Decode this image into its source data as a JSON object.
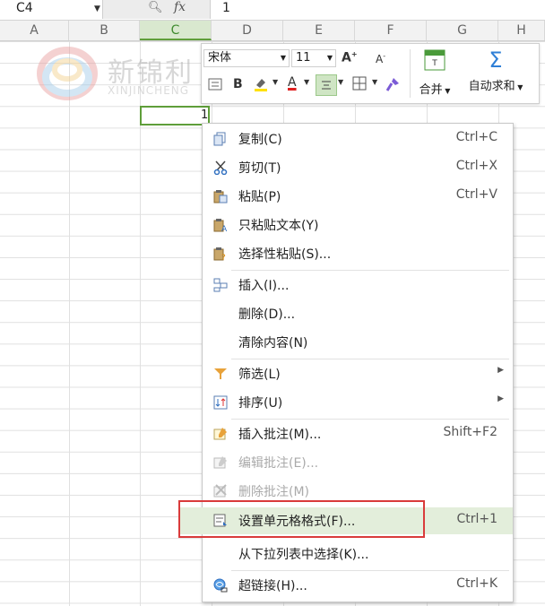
{
  "formula_bar": {
    "name_box": "C4",
    "zoom_icon": "magnifier-icon",
    "fx_label": "fx",
    "value": "1"
  },
  "columns": [
    "A",
    "B",
    "C",
    "D",
    "E",
    "F",
    "G",
    "H"
  ],
  "selected_column": "C",
  "cell_value": "1",
  "watermark": {
    "text1": "新锦利",
    "text2": "XINJINCHENG"
  },
  "mini_toolbar": {
    "font_name": "宋体",
    "font_size": "11",
    "increase_font": "A",
    "decrease_font": "A",
    "bold": "B",
    "font_color_letter": "A",
    "merge_label": "合并",
    "autosum_label": "自动求和",
    "autosum_icon": "Σ",
    "colors": {
      "highlight": "#ffe100",
      "font_color": "#e02020",
      "align_active": "#cfe5c4"
    }
  },
  "context_menu": {
    "items": [
      {
        "label": "复制(C)",
        "shortcut": "Ctrl+C",
        "icon": "copy-icon"
      },
      {
        "label": "剪切(T)",
        "shortcut": "Ctrl+X",
        "icon": "scissors-icon"
      },
      {
        "label": "粘贴(P)",
        "shortcut": "Ctrl+V",
        "icon": "paste-icon"
      },
      {
        "label": "只粘贴文本(Y)",
        "shortcut": "",
        "icon": "paste-text-icon"
      },
      {
        "label": "选择性粘贴(S)...",
        "shortcut": "",
        "icon": "paste-special-icon"
      },
      {
        "label": "插入(I)...",
        "shortcut": "",
        "icon": "insert-icon"
      },
      {
        "label": "删除(D)...",
        "shortcut": "",
        "icon": ""
      },
      {
        "label": "清除内容(N)",
        "shortcut": "",
        "icon": ""
      },
      {
        "label": "筛选(L)",
        "shortcut": "",
        "icon": "filter-icon",
        "submenu": true
      },
      {
        "label": "排序(U)",
        "shortcut": "",
        "icon": "sort-icon",
        "submenu": true
      },
      {
        "label": "插入批注(M)...",
        "shortcut": "Shift+F2",
        "icon": "insert-comment-icon"
      },
      {
        "label": "编辑批注(E)...",
        "shortcut": "",
        "icon": "edit-comment-icon",
        "disabled": true
      },
      {
        "label": "删除批注(M)",
        "shortcut": "",
        "icon": "delete-comment-icon",
        "disabled": true
      },
      {
        "label": "设置单元格格式(F)...",
        "shortcut": "Ctrl+1",
        "icon": "format-cells-icon",
        "highlighted": true
      },
      {
        "label": "从下拉列表中选择(K)...",
        "shortcut": "",
        "icon": ""
      },
      {
        "label": "超链接(H)...",
        "shortcut": "Ctrl+K",
        "icon": "hyperlink-icon"
      }
    ]
  },
  "annotation": {
    "color": "#d93b3b"
  }
}
